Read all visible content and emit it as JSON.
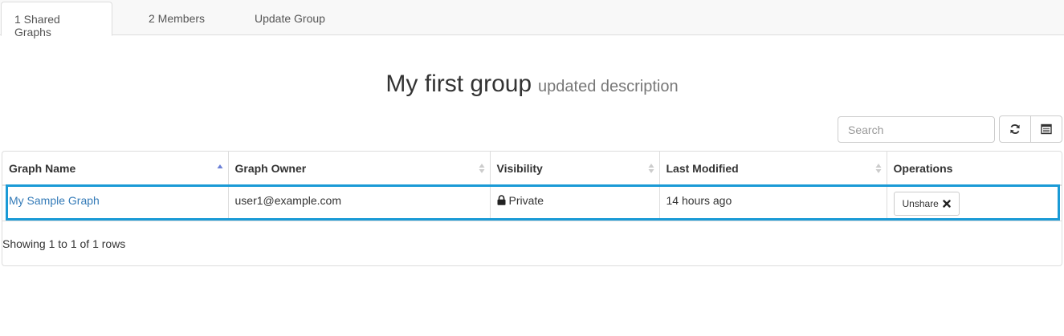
{
  "tabs": [
    {
      "label": "1 Shared Graphs",
      "active": true
    },
    {
      "label": "2 Members",
      "active": false
    },
    {
      "label": "Update Group",
      "active": false
    }
  ],
  "group": {
    "title": "My first group",
    "description": "updated description"
  },
  "toolbar": {
    "search_placeholder": "Search",
    "refresh_icon": "refresh-icon",
    "columns_icon": "columns-icon"
  },
  "table": {
    "columns": [
      {
        "label": "Graph Name",
        "sort": "asc"
      },
      {
        "label": "Graph Owner",
        "sort": "both"
      },
      {
        "label": "Visibility",
        "sort": "both"
      },
      {
        "label": "Last Modified",
        "sort": "both"
      },
      {
        "label": "Operations",
        "sort": "none"
      }
    ],
    "rows": [
      {
        "graph_name": "My Sample Graph",
        "graph_owner": "user1@example.com",
        "visibility": "Private",
        "visibility_icon": "lock-icon",
        "last_modified": "14 hours ago",
        "operation_label": "Unshare",
        "operation_icon": "close-icon"
      }
    ],
    "pagination_text": "Showing 1 to 1 of 1 rows"
  },
  "colors": {
    "highlight": "#1a9ad6",
    "link": "#337ab7",
    "sort_active": "#6b7fd6"
  }
}
